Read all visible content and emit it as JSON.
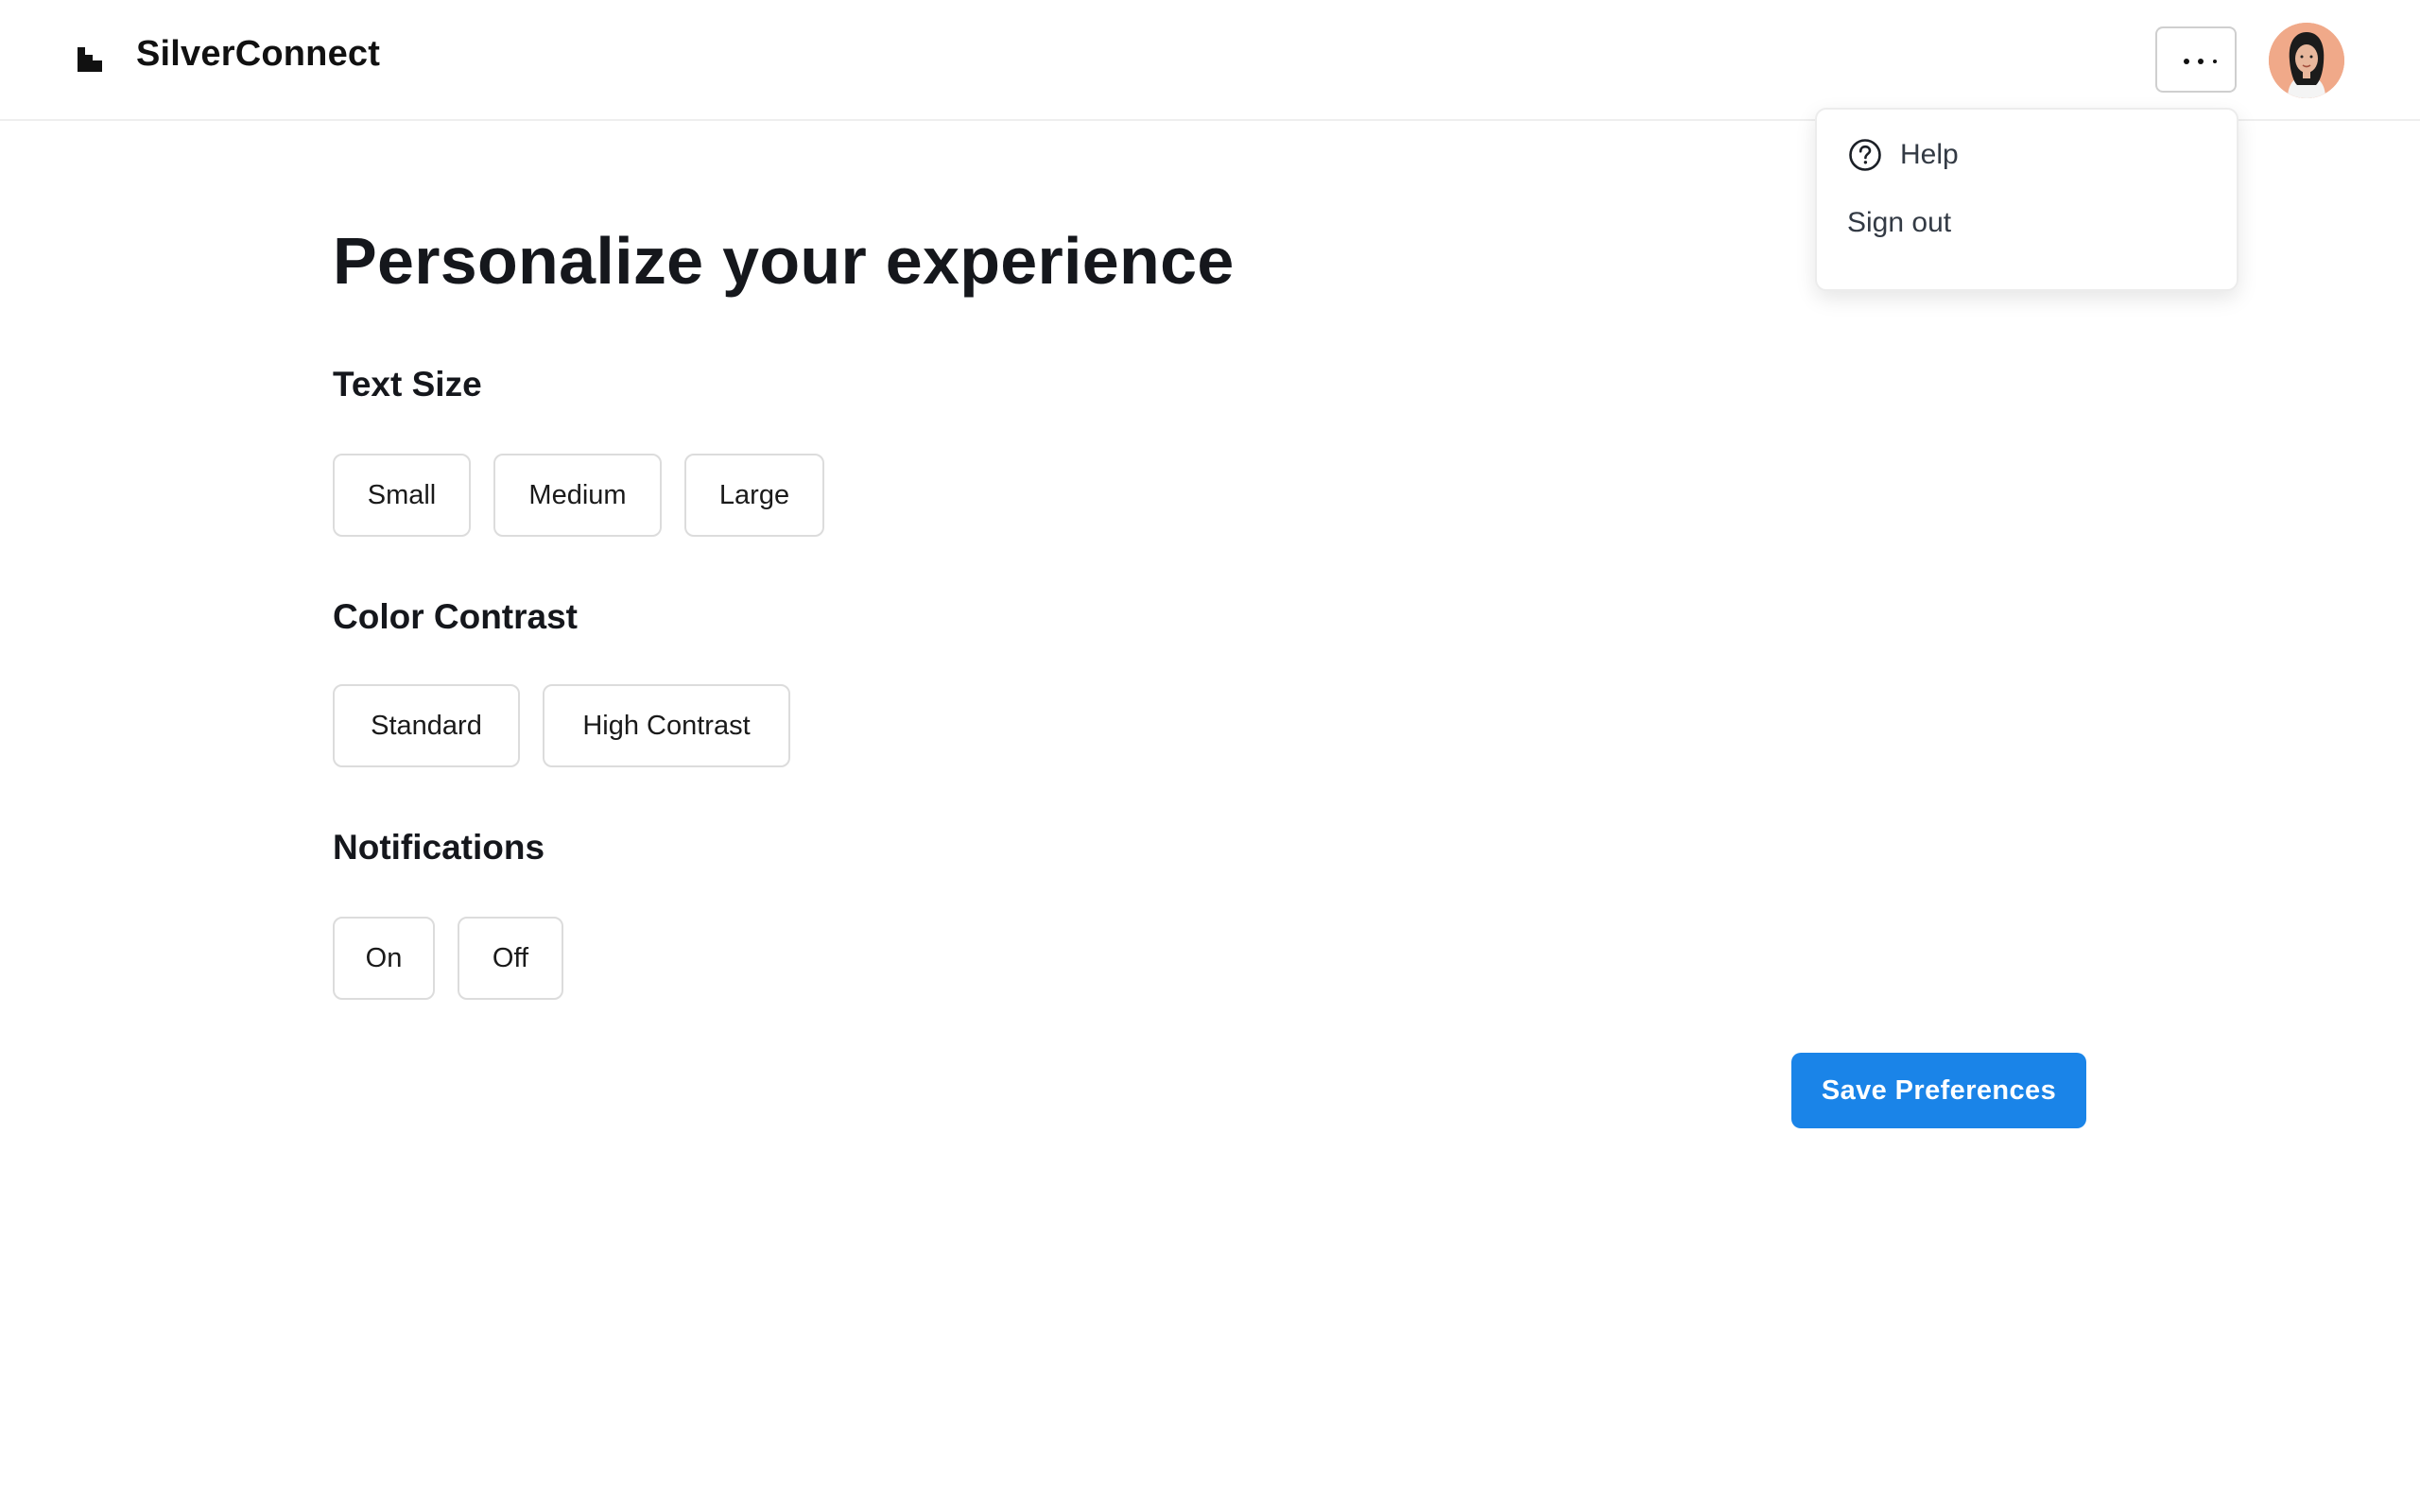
{
  "app": {
    "brand": "SilverConnect"
  },
  "header": {
    "more_icon": "more-horizontal-icon",
    "avatar_icon": "user-avatar"
  },
  "menu": {
    "items": [
      {
        "label": "Help",
        "icon": "help-circle-icon"
      },
      {
        "label": "Sign out"
      }
    ]
  },
  "main": {
    "title": "Personalize your experience",
    "sections": [
      {
        "label": "Text Size",
        "options": [
          "Small",
          "Medium",
          "Large"
        ]
      },
      {
        "label": "Color Contrast",
        "options": [
          "Standard",
          "High Contrast"
        ]
      },
      {
        "label": "Notifications",
        "options": [
          "On",
          "Off"
        ]
      }
    ],
    "save_label": "Save Preferences"
  },
  "colors": {
    "accent": "#1a84e8",
    "text": "#15171c",
    "border": "#dcdcdc"
  }
}
